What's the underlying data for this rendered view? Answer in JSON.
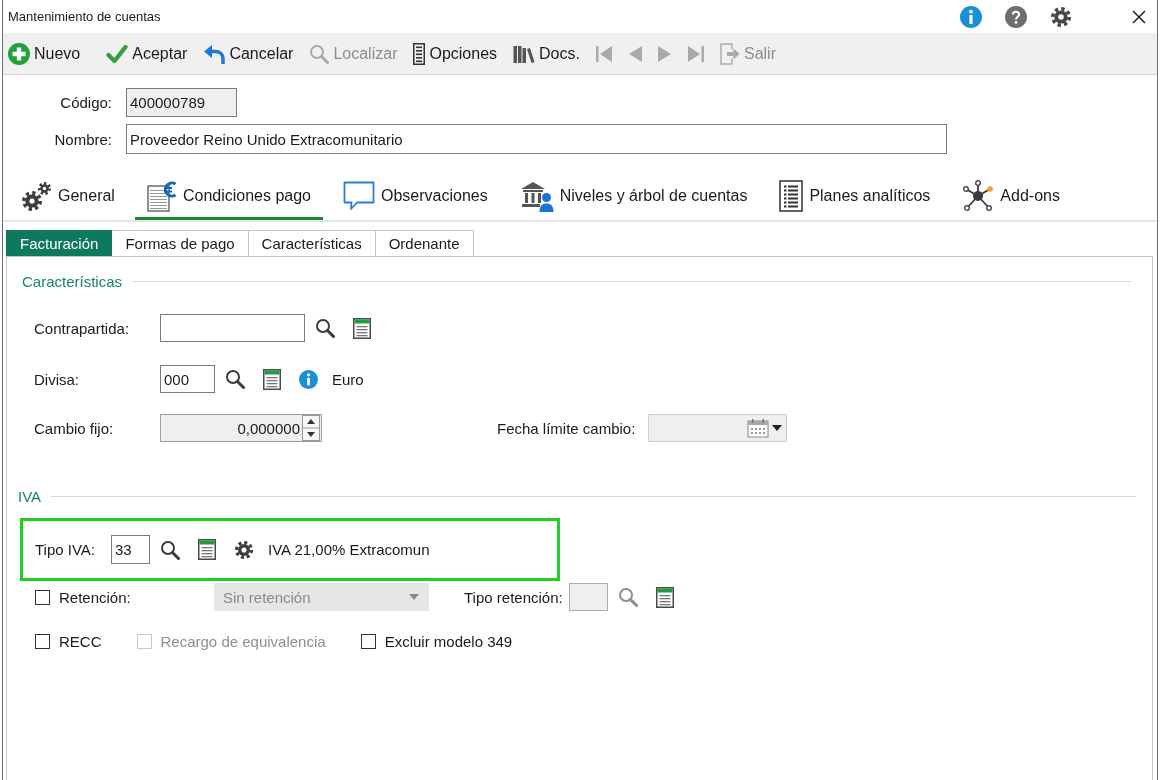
{
  "window": {
    "title": "Mantenimiento de cuentas"
  },
  "toolbar": [
    {
      "kind": "new",
      "label": "Nuevo",
      "disabled": false
    },
    {
      "kind": "accept",
      "label": "Aceptar",
      "disabled": false
    },
    {
      "kind": "cancel",
      "label": "Cancelar",
      "disabled": false
    },
    {
      "kind": "find",
      "label": "Localizar",
      "disabled": true
    },
    {
      "kind": "options",
      "label": "Opciones",
      "disabled": false
    },
    {
      "kind": "docs",
      "label": "Docs.",
      "disabled": false
    },
    {
      "kind": "first",
      "disabled": true
    },
    {
      "kind": "previous",
      "disabled": true
    },
    {
      "kind": "next",
      "disabled": true
    },
    {
      "kind": "last",
      "disabled": true
    },
    {
      "kind": "exit",
      "label": "Salir",
      "disabled": true
    }
  ],
  "header_fields": [
    {
      "label": "Código:",
      "value": "400000789",
      "readonly": true
    },
    {
      "label": "Nombre:",
      "value": "Proveedor Reino Unido Extracomunitario",
      "readonly": false
    }
  ],
  "main_tabs": [
    {
      "kind": "general",
      "label": "General",
      "selected": false
    },
    {
      "kind": "payment",
      "label": "Condiciones pago",
      "selected": true
    },
    {
      "kind": "notes",
      "label": "Observaciones",
      "selected": false
    },
    {
      "kind": "levels",
      "label": "Niveles y árbol de cuentas",
      "selected": false
    },
    {
      "kind": "analytics",
      "label": "Planes analíticos",
      "selected": false
    },
    {
      "kind": "addons",
      "label": "Add-ons",
      "selected": false
    }
  ],
  "sub_tabs": [
    {
      "label": "Facturación",
      "selected": true
    },
    {
      "label": "Formas de pago",
      "selected": false
    },
    {
      "label": "Características",
      "selected": false
    },
    {
      "label": "Ordenante",
      "selected": false
    }
  ],
  "caracteristicas": {
    "title": "Características",
    "contrapartida": {
      "label": "Contrapartida:",
      "disabled": false
    },
    "divisa": {
      "label": "Divisa:",
      "value": "000",
      "disabled": false,
      "description": "Euro"
    },
    "cambio_fijo": {
      "label": "Cambio fijo:",
      "value": "0,000000",
      "disabled": true
    },
    "fecha_limite_cambio": {
      "label": "Fecha límite cambio:",
      "disabled": true
    }
  },
  "iva": {
    "title": "IVA",
    "tipo_iva": {
      "label": "Tipo IVA:",
      "value": "33",
      "disabled": false,
      "description": "IVA 21,00% Extracomun",
      "highlighted": true
    },
    "retencion": {
      "label": "Retención:",
      "checked": false,
      "select_value": "Sin retención",
      "select_disabled": true
    },
    "tipo_retencion": {
      "label": "Tipo retención:",
      "disabled": true
    },
    "checkboxes": [
      {
        "label": "RECC",
        "checked": false,
        "disabled": false
      },
      {
        "label": "Recargo de equivalencia",
        "checked": false,
        "disabled": true
      },
      {
        "label": "Excluir modelo 349",
        "checked": false,
        "disabled": false
      }
    ]
  }
}
